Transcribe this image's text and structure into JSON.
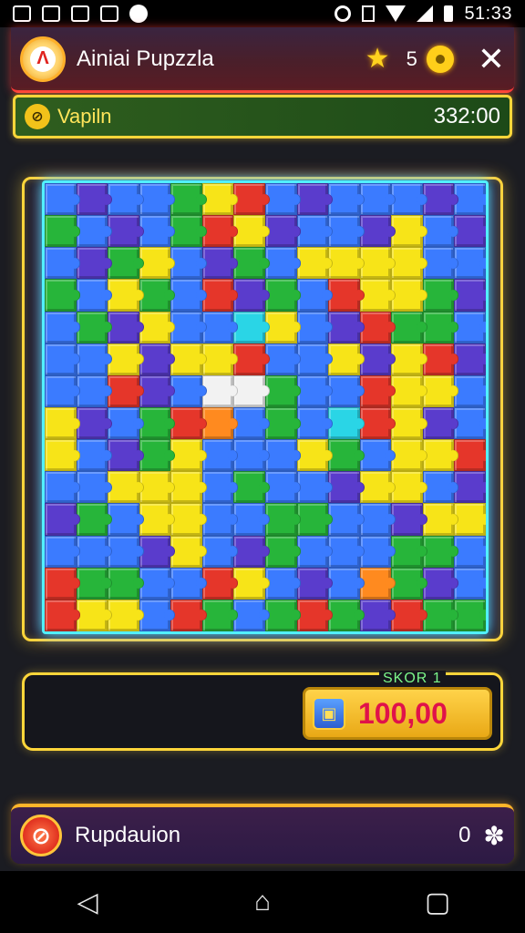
{
  "status_bar": {
    "time": "5⁠1:33",
    "left_icons": [
      "image-icon",
      "game-icon",
      "puzzle-icon",
      "photo-icon",
      "message-icon"
    ],
    "right_icons": [
      "alarm-icon",
      "vibrate-icon",
      "wifi-icon",
      "signal-icon",
      "battery-icon"
    ]
  },
  "header": {
    "title": "Ainiai Pupzzla",
    "coin_count": "5"
  },
  "level_bar": {
    "label": "Vapiln",
    "timer": "332:00"
  },
  "score": {
    "label": "SKOR 1",
    "value": "100,00"
  },
  "bottom_bar": {
    "label": "Rupdauion",
    "count": "0"
  },
  "colors": {
    "blue": "#3b7bff",
    "green": "#27b53a",
    "yellow": "#f7e418",
    "red": "#e5362a",
    "purple": "#5a3ccc",
    "orange": "#ff8a1f",
    "cyan": "#2ad5e6",
    "white": "#f2f2f2"
  },
  "board_grid": [
    "bpbbgyrbpbbbpb",
    "gbpbgrypbbpybp",
    "bpgybpgbyyyybb",
    "gbygbrpgbryygp",
    "bgpybbcybprggb",
    "bbypyyrbbypyrp",
    "bbrpbwwgbbryyb",
    "ypbgrobgbcrypb",
    "ybpgybbbygbyyr",
    "bbyyybgbbpyybp",
    "pgbyybbggbbpyy",
    "bbbpybpgbbbggb",
    "rggbbrybpbogpb",
    "ryybrgbgrgprgg"
  ]
}
